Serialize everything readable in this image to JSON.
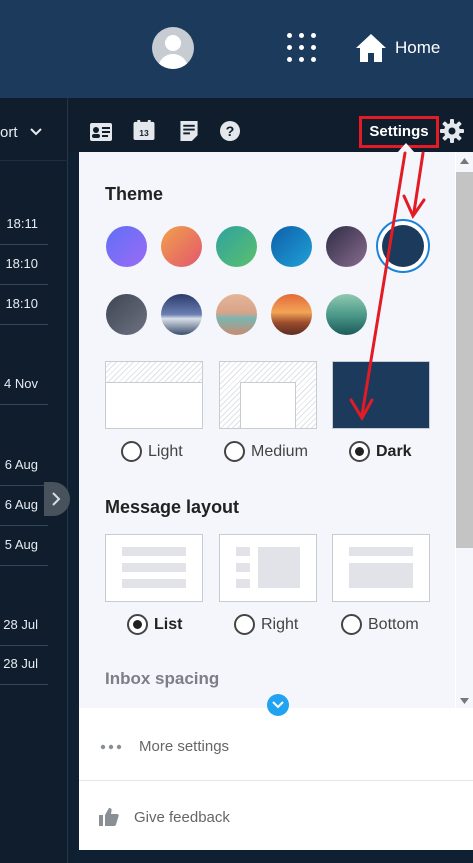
{
  "header": {
    "home_label": "Home"
  },
  "left_list": {
    "sort_label": "ort",
    "rows": [
      "18:11",
      "18:10",
      "18:10",
      "4 Nov",
      "6 Aug",
      "6 Aug",
      "5 Aug",
      "28 Jul",
      "28 Jul"
    ]
  },
  "toolbar": {
    "settings_label": "Settings",
    "calendar_day": "13"
  },
  "settings": {
    "theme_title": "Theme",
    "theme_modes": [
      {
        "label": "Light",
        "selected": false
      },
      {
        "label": "Medium",
        "selected": false
      },
      {
        "label": "Dark",
        "selected": true
      }
    ],
    "message_layout_title": "Message layout",
    "message_layouts": [
      {
        "label": "List",
        "selected": true
      },
      {
        "label": "Right",
        "selected": false
      },
      {
        "label": "Bottom",
        "selected": false
      }
    ],
    "inbox_spacing_title": "Inbox spacing",
    "more_settings_label": "More settings",
    "give_feedback_label": "Give feedback"
  },
  "colors": {
    "header_bg": "#1b3a5c",
    "dark_bg": "#0f1d2c",
    "accent_blue": "#1a82d8",
    "annotation_red": "#e21b24",
    "selected_theme_fill": "#1b3a5c"
  },
  "icons": [
    "user-avatar-icon",
    "app-grid-icon",
    "home-icon",
    "contact-card-icon",
    "calendar-icon",
    "notes-icon",
    "help-icon",
    "gear-icon",
    "chevron-down-icon",
    "chevron-right-icon",
    "ellipsis-icon",
    "thumbs-up-icon"
  ]
}
